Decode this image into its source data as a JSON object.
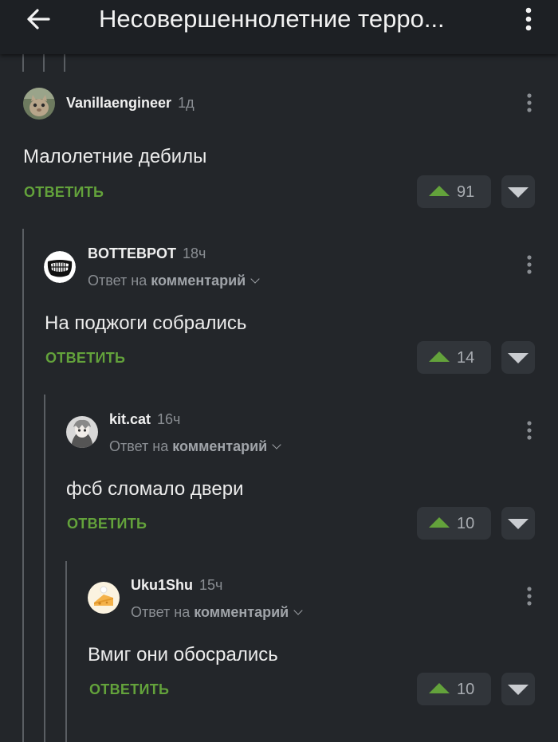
{
  "header": {
    "title": "Несовершеннолетние терро...",
    "back_icon": "arrow-left-icon",
    "menu_icon": "kebab-menu-icon"
  },
  "colors": {
    "background": "#23262a",
    "topbar": "#1d2024",
    "accent_green": "#63a23b",
    "thread_line": "#5a5e63"
  },
  "comments": [
    {
      "username": "Vanillaengineer",
      "time": "1д",
      "reply_to": null,
      "text": "Малолетние дебилы",
      "reply_label": "ОТВЕТИТЬ",
      "votes": "91"
    },
    {
      "username": "BOTTEBPOT",
      "time": "18ч",
      "reply_prefix": "Ответ на",
      "reply_target": "комментарий",
      "text": "На поджоги собрались",
      "reply_label": "ОТВЕТИТЬ",
      "votes": "14"
    },
    {
      "username": "kit.cat",
      "time": "16ч",
      "reply_prefix": "Ответ на",
      "reply_target": "комментарий",
      "text": "фсб сломало двери",
      "reply_label": "ОТВЕТИТЬ",
      "votes": "10"
    },
    {
      "username": "Uku1Shu",
      "time": "15ч",
      "reply_prefix": "Ответ на",
      "reply_target": "комментарий",
      "text": "Вмиг они обосрались",
      "reply_label": "ОТВЕТИТЬ",
      "votes": "10"
    }
  ]
}
